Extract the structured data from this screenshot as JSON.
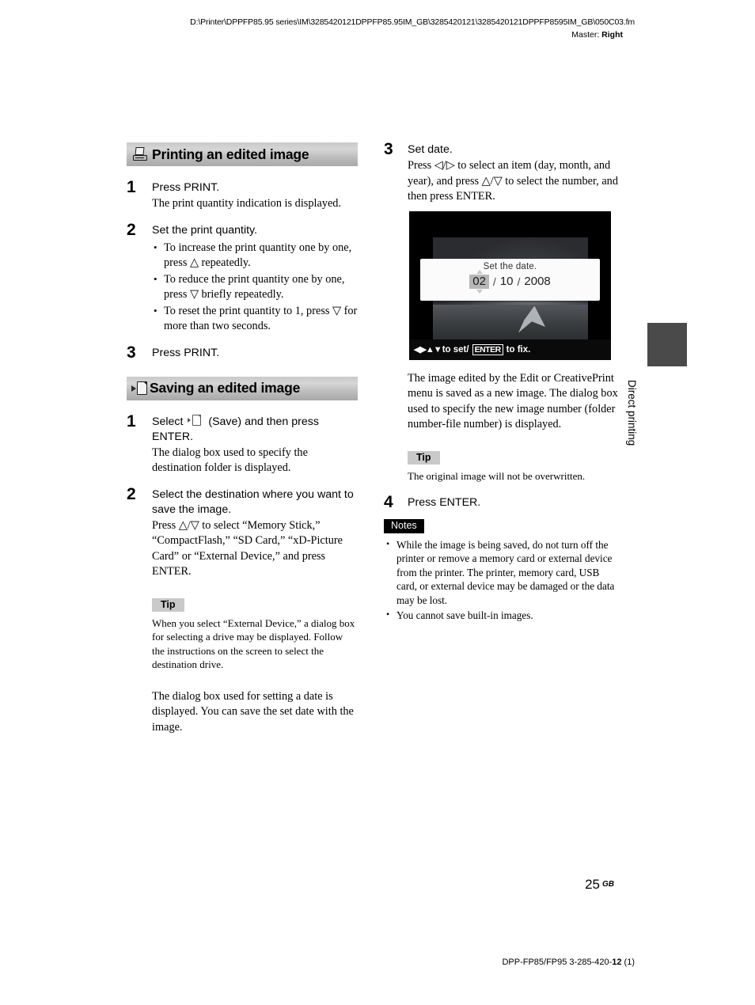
{
  "header": {
    "filepath": "D:\\Printer\\DPPFP85.95 series\\IM\\3285420121DPPFP85.95IM_GB\\3285420121\\3285420121DPPFP8595IM_GB\\050C03.fm",
    "master_label": "Master: ",
    "master_value": "Right"
  },
  "left_column": {
    "section1": {
      "icon": "printer-icon",
      "title": "Printing an edited image",
      "steps": [
        {
          "number": "1",
          "lead": "Press PRINT.",
          "detail": "The print quantity indication is displayed."
        },
        {
          "number": "2",
          "lead": "Set the print quantity.",
          "bullets": [
            "To increase the print quantity one by one, press △ repeatedly.",
            "To reduce the print quantity one by one, press ▽ briefly repeatedly.",
            "To reset the print quantity to 1, press ▽ for more than two seconds."
          ]
        },
        {
          "number": "3",
          "lead": "Press PRINT."
        }
      ]
    },
    "section2": {
      "icon": "save-icon",
      "title": "Saving an edited image",
      "steps": [
        {
          "number": "1",
          "lead_pre": "Select",
          "lead_post": "(Save) and then press ENTER.",
          "detail": "The dialog box used to specify the destination folder is displayed."
        },
        {
          "number": "2",
          "lead": "Select the destination where you want to save the image.",
          "detail": "Press △/▽ to select “Memory Stick,” “CompactFlash,” “SD Card,” “xD-Picture Card” or “External Device,” and press ENTER."
        }
      ],
      "tip": {
        "label": "Tip",
        "text": "When you select “External Device,” a dialog box for selecting a drive may be displayed. Follow the instructions on the screen to select the destination drive."
      },
      "closing": "The dialog box used for setting a date is displayed. You can save the set date with the image."
    }
  },
  "right_column": {
    "step3": {
      "number": "3",
      "lead": "Set date.",
      "detail": "Press ◁/▷ to select an item (day, month, and year), and press △/▽ to select the number, and then press ENTER."
    },
    "lcd": {
      "dialog_title": "Set the date.",
      "day": "02",
      "separator1": "/",
      "month": "10",
      "separator2": "/",
      "year": "2008",
      "status_arrows": "◀▶▲▼",
      "status_prefix": "to set/",
      "status_key": "ENTER",
      "status_suffix": "to fix."
    },
    "after_image": "The image edited by the Edit or CreativePrint menu is saved as a new image. The dialog box used to specify the new image number (folder number-file number) is displayed.",
    "tip": {
      "label": "Tip",
      "text": "The original image will not be overwritten."
    },
    "step4": {
      "number": "4",
      "lead": "Press ENTER."
    },
    "notes": {
      "label": "Notes",
      "items": [
        "While the image is being saved, do not turn off the printer or remove a memory card or external device from the printer. The printer, memory card, USB card, or external device may be damaged or the data may be lost.",
        "You cannot save built-in images."
      ]
    }
  },
  "side_tab": {
    "label": "Direct printing"
  },
  "footer": {
    "page_number": "25",
    "page_suffix": "GB",
    "model_line_pre": "DPP-FP85/FP95 3-285-420-",
    "model_line_bold": "12",
    "model_line_post": " (1)"
  }
}
